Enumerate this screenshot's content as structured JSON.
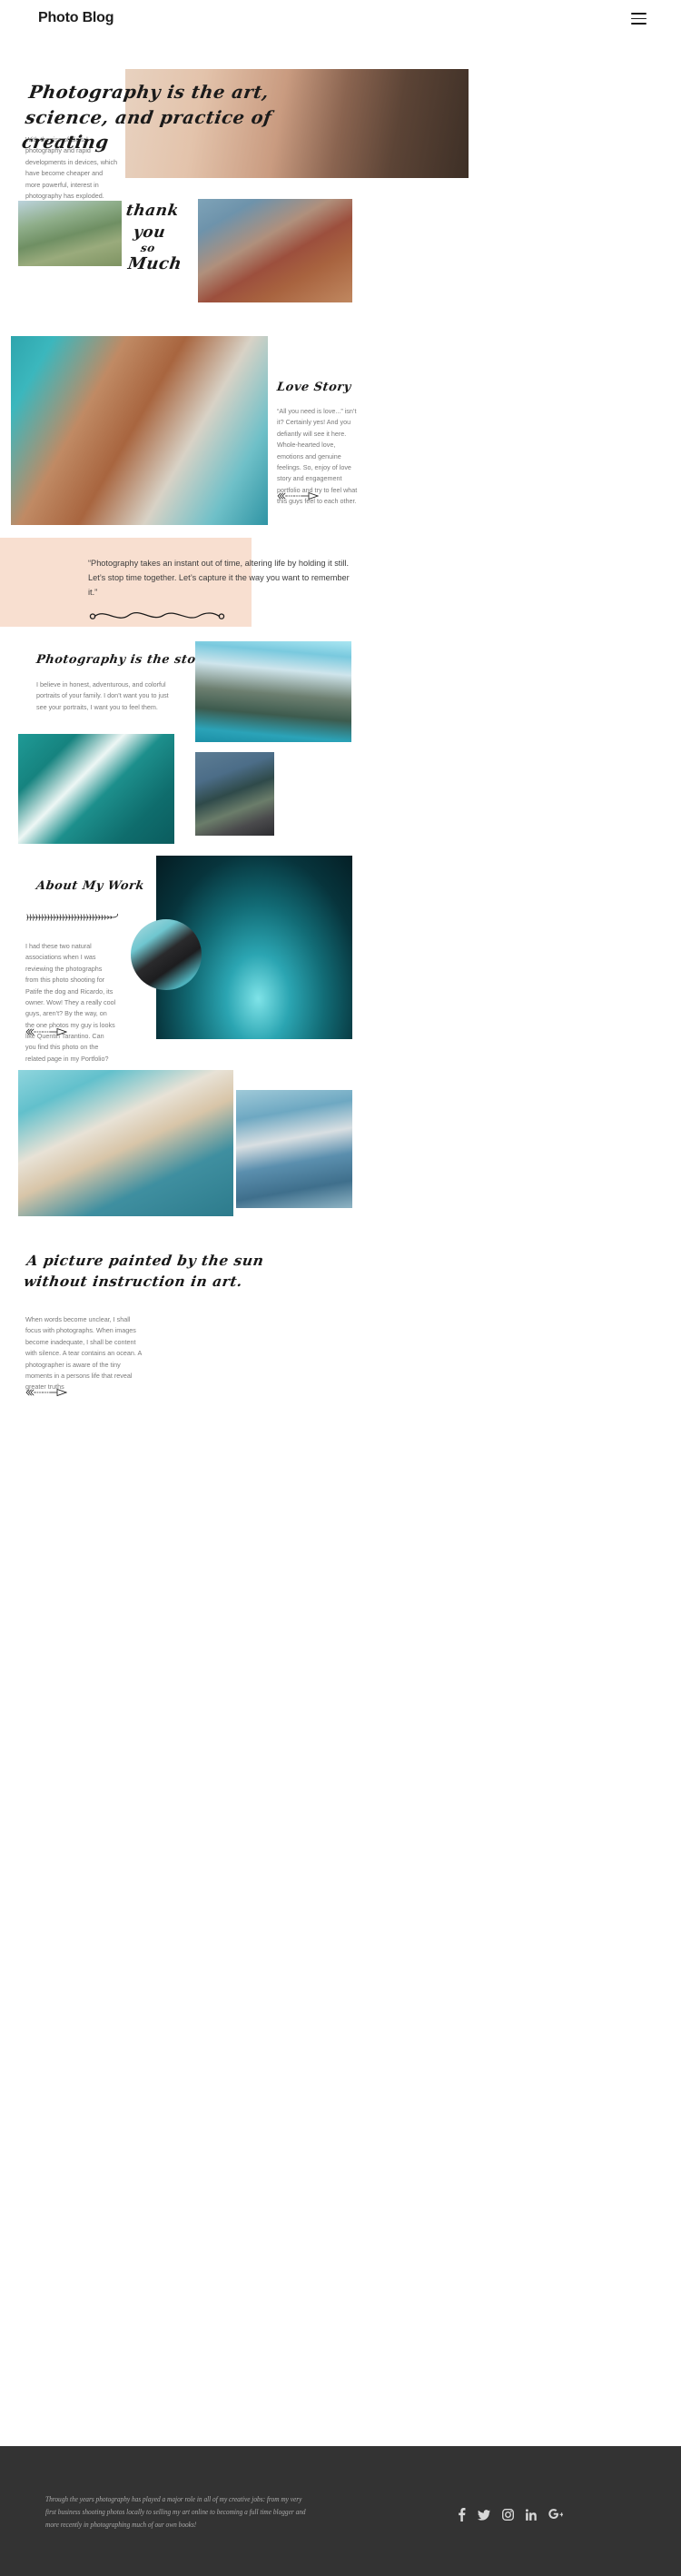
{
  "header": {
    "brand": "Photo Blog",
    "menu_icon": "hamburger-icon"
  },
  "hero": {
    "title": "Photography is the art, science, and practice of creating",
    "paragraph": "With the rise of digital photography and rapid developments in devices, which have become cheaper and more powerful, interest in photography has exploded.",
    "ornament": "arrow-ornament"
  },
  "gallery_top": {
    "thank_you_line1": "thank",
    "thank_you_line2": "you",
    "thank_you_line3": "so",
    "thank_you_line4": "Much",
    "image_hands_alt": "couple-holding-hands",
    "image_embrace_alt": "denim-embrace"
  },
  "love_story": {
    "title": "Love Story",
    "paragraph": "“All you need is love...” isn’t it? Certainly yes! And you defiantly will see it here. Whole-hearted love, emotions and genuine feelings. So, enjoy of love story and engagement portfolio and try to feel what this guys feel to each other.",
    "image_alt": "bride-and-groom"
  },
  "quote": {
    "text": "“Photography takes an instant out of time, altering life by holding it still. Let’s stop time together. Let’s capture it the way you want to remember it.”",
    "band_color": "#f8dfd0",
    "ornament": "wave-ornament"
  },
  "story": {
    "title": "Photography is the story",
    "paragraph": "I believe in honest, adventurous, and colorful portraits of your family. I don’t want you to just see your portraits, I want you to feel them.",
    "image_mountain_alt": "mountain-lake",
    "image_ocean_alt": "aerial-surfers",
    "image_road_alt": "person-on-road"
  },
  "about": {
    "title": "About My Work",
    "paragraph": "I had these two natural associations when I was reviewing the photographs from this photo shooting for Patife the dog and Ricardo, its owner. Wow! They a really cool guys, aren’t? By the way, on the one photos my guy is looks like Quentin Tarantino. Can you find this photo on the related page in my Portfolio?",
    "ornament_top": "fern-ornament",
    "ornament_bottom": "arrow-ornament",
    "image_desk_alt": "desk-setup-monitor",
    "image_lens_alt": "hand-holding-lens"
  },
  "gallery_bottom": {
    "image_hat_alt": "woman-with-hat-beach",
    "image_street_alt": "blue-street-stairs"
  },
  "sun": {
    "title": "A picture painted by the sun without instruction in art.",
    "paragraph": "When words become unclear, I shall focus with photographs. When images become inadequate, I shall be content with silence. A tear contains an ocean. A photographer is aware of the tiny moments in a persons life that reveal greater truths",
    "ornament": "arrow-ornament"
  },
  "footer": {
    "text": "Through the years photography has played a major role in all of my creative jobs: from my very first business shooting photos locally to selling my art online to becoming a full time blogger and more recently in photographing much of our own books!",
    "background": "#333333",
    "social": [
      {
        "name": "facebook-icon",
        "label": "f"
      },
      {
        "name": "twitter-icon",
        "label": "t"
      },
      {
        "name": "instagram-icon",
        "label": "ig"
      },
      {
        "name": "linkedin-icon",
        "label": "in"
      },
      {
        "name": "googleplus-icon",
        "label": "G+"
      }
    ]
  }
}
